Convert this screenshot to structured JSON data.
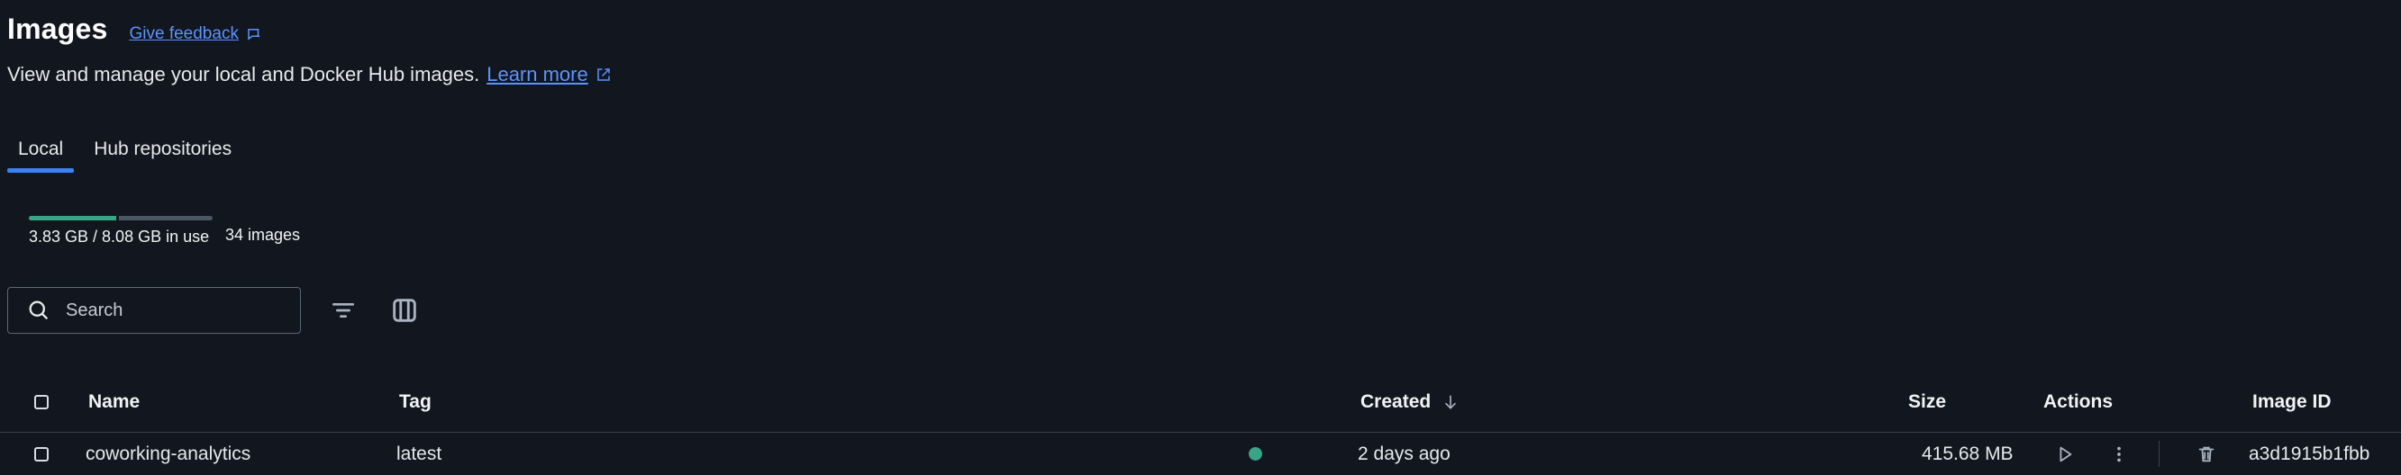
{
  "header": {
    "title": "Images",
    "feedback_label": "Give feedback",
    "subtitle": "View and manage your local and Docker Hub images.",
    "learn_more_label": "Learn more"
  },
  "tabs": [
    {
      "label": "Local",
      "active": true
    },
    {
      "label": "Hub repositories",
      "active": false
    }
  ],
  "usage": {
    "text": "3.83 GB / 8.08 GB in use",
    "used_fraction": 0.474,
    "count_text": "34 images"
  },
  "search": {
    "placeholder": "Search"
  },
  "table": {
    "columns": {
      "name": "Name",
      "tag": "Tag",
      "created": "Created",
      "size": "Size",
      "actions": "Actions",
      "image_id": "Image ID"
    },
    "rows": [
      {
        "name": "coworking-analytics",
        "tag": "latest",
        "status": "in-use",
        "created": "2 days ago",
        "size": "415.68 MB",
        "image_id": "a3d1915b1fbb"
      }
    ]
  },
  "colors": {
    "accent": "#3b82f6",
    "link": "#5b94ff",
    "in_use": "#3aa586",
    "background": "#12161e"
  },
  "icons": {
    "feedback": "feedback-icon",
    "external_link": "external-link-icon",
    "search": "search-icon",
    "filter": "filter-icon",
    "columns": "columns-icon",
    "sort": "sort-down-icon",
    "run": "play-icon",
    "more": "more-vertical-icon",
    "delete": "trash-icon"
  }
}
